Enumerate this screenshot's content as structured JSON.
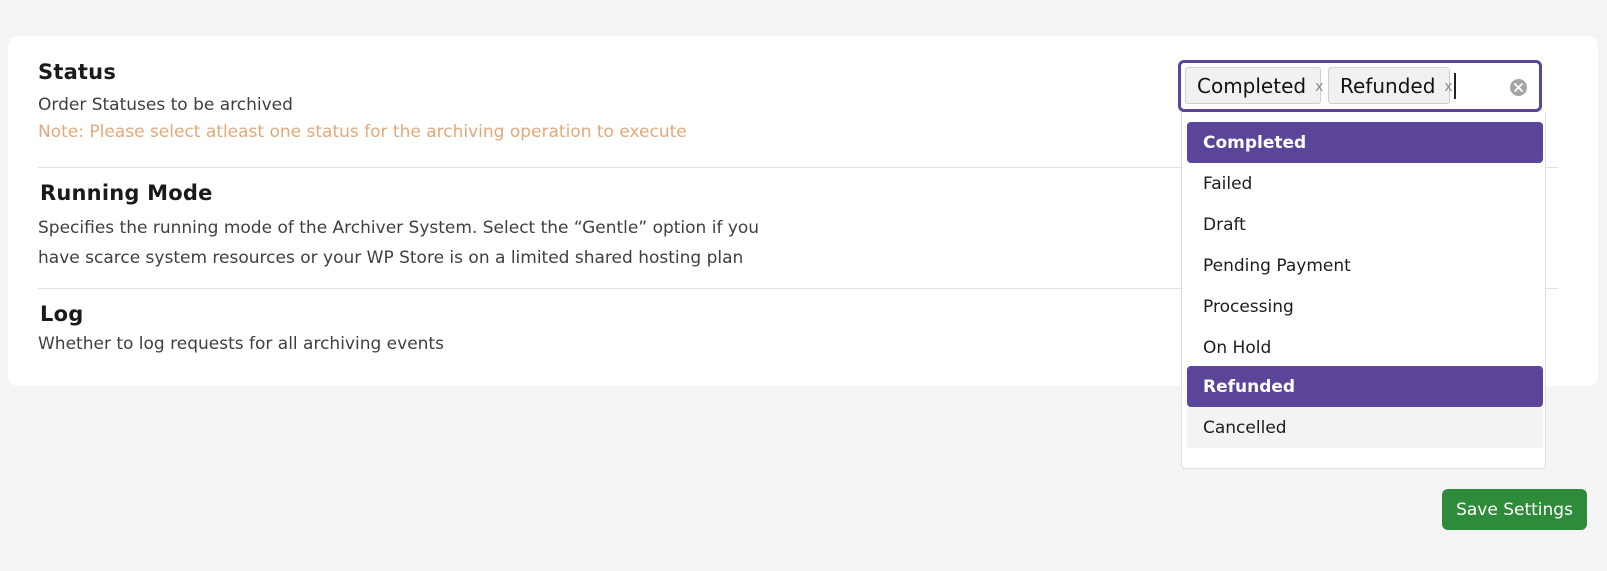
{
  "status": {
    "title": "Status",
    "description": "Order Statuses to be archived",
    "note": "Note: Please select atleast one status for the archiving operation to execute"
  },
  "running_mode": {
    "title": "Running Mode",
    "description_line1": "Specifies the running mode of the Archiver System. Select the “Gentle” option if you",
    "description_line2": "have scarce system resources or your WP Store is on a limited shared hosting plan"
  },
  "log": {
    "title": "Log",
    "description": "Whether to log requests for all archiving events"
  },
  "multiselect": {
    "chips": [
      {
        "label": "Completed",
        "remove": "x"
      },
      {
        "label": "Refunded",
        "remove": "x"
      }
    ],
    "clear_icon": "circle-x-icon"
  },
  "dropdown": {
    "options": [
      {
        "label": "Completed",
        "selected": true
      },
      {
        "label": "Failed",
        "selected": false
      },
      {
        "label": "Draft",
        "selected": false
      },
      {
        "label": "Pending Payment",
        "selected": false
      },
      {
        "label": "Processing",
        "selected": false
      },
      {
        "label": "On Hold",
        "selected": false
      },
      {
        "label": "Refunded",
        "selected": true
      },
      {
        "label": "Cancelled",
        "selected": false,
        "highlighted": true
      }
    ]
  },
  "save_button": {
    "label": "Save Settings"
  },
  "colors": {
    "accent": "#5b4599",
    "note": "#e3a97a",
    "save": "#2e8b3a",
    "background": "#f4f4f4"
  }
}
